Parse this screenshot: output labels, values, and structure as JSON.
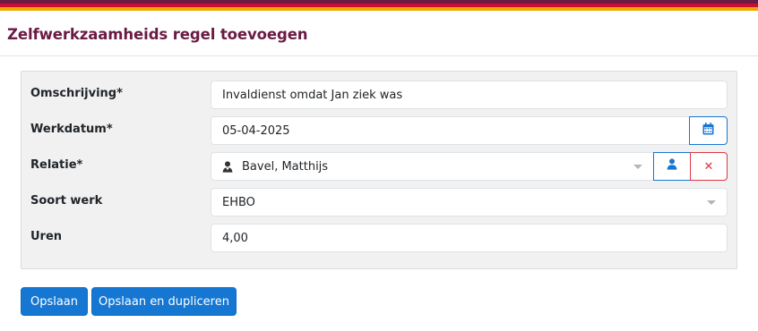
{
  "page": {
    "title": "Zelfwerkzaamheids regel toevoegen"
  },
  "form": {
    "description": {
      "label": "Omschrijving*",
      "value": "Invaldienst omdat Jan ziek was"
    },
    "date": {
      "label": "Werkdatum*",
      "value": "05-04-2025",
      "button_icon": "calendar-icon"
    },
    "relation": {
      "label": "Relatie*",
      "value": "Bavel, Matthijs",
      "icon": "user-icon",
      "select_button_icon": "user-icon",
      "clear_button_icon": "close-icon",
      "clear_symbol": "✕"
    },
    "work_type": {
      "label": "Soort werk",
      "value": "EHBO"
    },
    "hours": {
      "label": "Uren",
      "value": "4,00"
    }
  },
  "actions": {
    "save_label": "Opslaan",
    "save_duplicate_label": "Opslaan en dupliceren"
  },
  "colors": {
    "brand": "#6b1a44",
    "stripe_red": "#c8102e",
    "stripe_yellow": "#f0a800",
    "primary": "#1677d2",
    "danger": "#dc3545"
  }
}
